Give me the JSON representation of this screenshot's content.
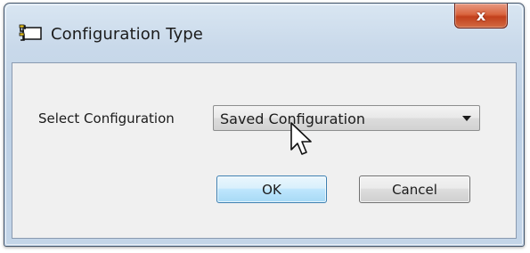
{
  "window": {
    "title": "Configuration Type",
    "close_glyph": "x"
  },
  "form": {
    "select_label": "Select Configuration",
    "select_value": "Saved Configuration"
  },
  "buttons": {
    "ok_label": "OK",
    "cancel_label": "Cancel"
  },
  "icons": {
    "app_icon": "window-config-icon",
    "close_icon": "close-icon",
    "dropdown_icon": "chevron-down-icon",
    "cursor": "mouse-pointer-icon"
  },
  "colors": {
    "close_button": "#c2401c",
    "ok_button_border": "#3c7fb1",
    "client_background": "#f0f0f0"
  }
}
